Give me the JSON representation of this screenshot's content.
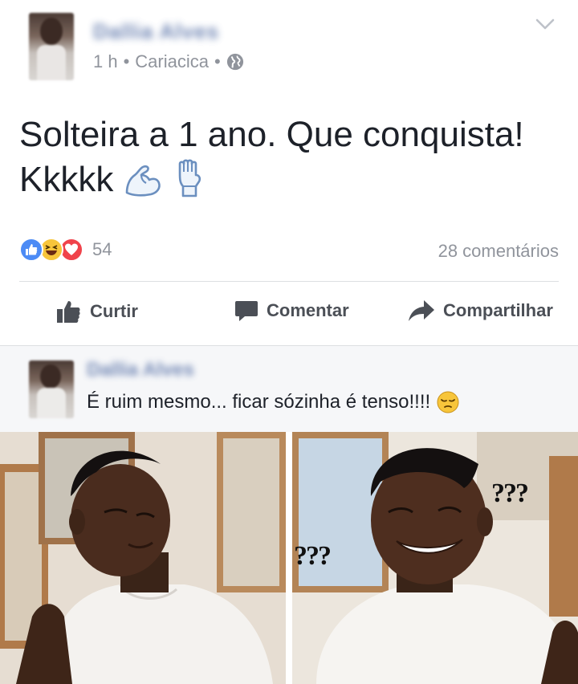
{
  "post": {
    "author_name": "Dallia Alves",
    "time": "1 h",
    "separator": "•",
    "location": "Cariacica",
    "text_line1": "Solteira a 1 ano. Que conquista!",
    "text_line2": "Kkkkk",
    "icons": {
      "privacy": "globe-icon",
      "menu": "chevron-down-icon",
      "emojis": [
        "flexed-biceps-icon",
        "raised-fist-icon"
      ]
    }
  },
  "reactions": {
    "types": [
      "like",
      "haha",
      "love"
    ],
    "count": "54",
    "comments": "28 comentários"
  },
  "actions": {
    "like": "Curtir",
    "comment": "Comentar",
    "share": "Compartilhar"
  },
  "comment": {
    "author_name": "Dallia Alves",
    "text": "É ruim mesmo... ficar sózinha é tenso!!!!",
    "emoji": "pensive-face-icon"
  },
  "meme": {
    "left_marks": "???",
    "right_marks_top": "???",
    "right_marks_bottom": "???"
  },
  "colors": {
    "brand_blue": "#3b5998",
    "muted_text": "#90949c",
    "action_text": "#4b4f56",
    "like_blue": "#4c8bf5",
    "love_red": "#f0434b",
    "haha_yellow": "#f7c53b"
  }
}
